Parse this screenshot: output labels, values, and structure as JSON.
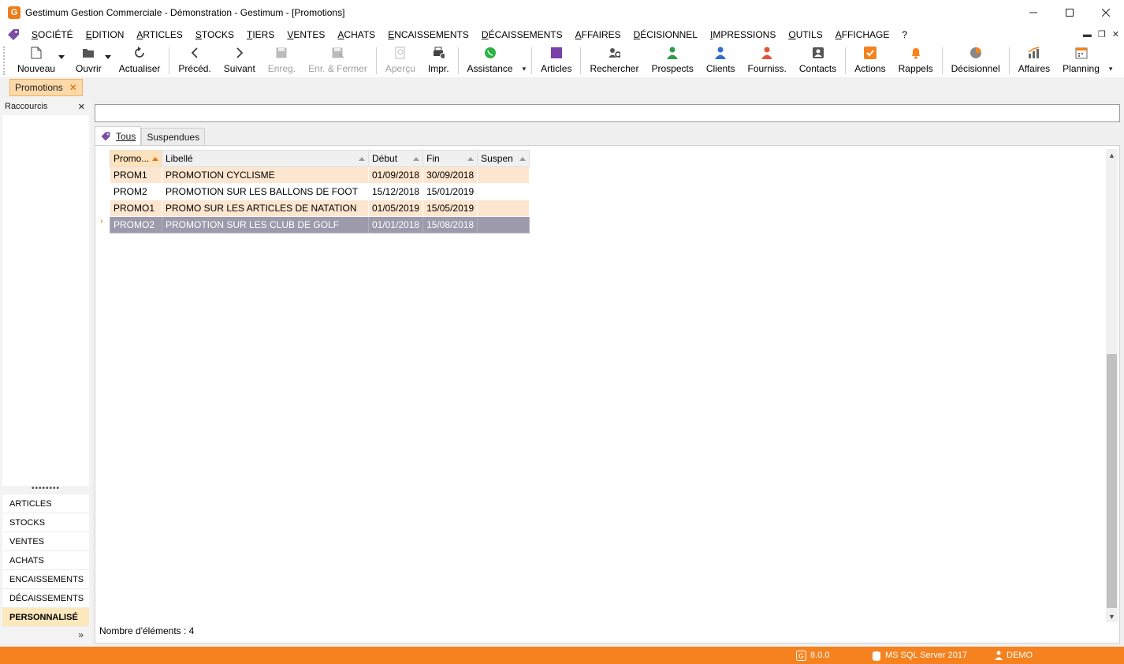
{
  "window": {
    "title": "Gestimum Gestion Commerciale - Démonstration - Gestimum - [Promotions]"
  },
  "menu": [
    "SOCIÉTÉ",
    "EDITION",
    "ARTICLES",
    "STOCKS",
    "TIERS",
    "VENTES",
    "ACHATS",
    "ENCAISSEMENTS",
    "DÉCAISSEMENTS",
    "AFFAIRES",
    "DÉCISIONNEL",
    "IMPRESSIONS",
    "OUTILS",
    "AFFICHAGE",
    "?"
  ],
  "toolbar": {
    "nouveau": "Nouveau",
    "ouvrir": "Ouvrir",
    "actualiser": "Actualiser",
    "preced": "Précéd.",
    "suivant": "Suivant",
    "enreg": "Enreg.",
    "enr_fermer": "Enr. & Fermer",
    "apercu": "Aperçu",
    "impr": "Impr.",
    "assistance": "Assistance",
    "articles": "Articles",
    "rechercher": "Rechercher",
    "prospects": "Prospects",
    "clients": "Clients",
    "fourniss": "Fourniss.",
    "contacts": "Contacts",
    "actions": "Actions",
    "rappels": "Rappels",
    "decisionnel": "Décisionnel",
    "affaires": "Affaires",
    "planning": "Planning"
  },
  "colors": {
    "accent": "#f5821f",
    "selected_row": "#9c9aab",
    "alt_row": "#fde6cf",
    "tab_active": "#fdd9a9"
  },
  "doc_tab": {
    "label": "Promotions",
    "close": "✕"
  },
  "sidebar": {
    "header": "Raccourcis",
    "close": "✕",
    "dots": "••••••••",
    "items": [
      "ARTICLES",
      "STOCKS",
      "VENTES",
      "ACHATS",
      "ENCAISSEMENTS",
      "DÉCAISSEMENTS",
      "PERSONNALISÉ"
    ],
    "more": "»"
  },
  "search": {
    "value": "",
    "placeholder": ""
  },
  "tabs": {
    "tous": "Tous",
    "suspendues": "Suspendues"
  },
  "grid": {
    "columns": [
      "Promo...",
      "Libellé",
      "Début",
      "Fin",
      "Suspen"
    ],
    "rows": [
      [
        "PROM1",
        "PROMOTION CYCLISME",
        "01/09/2018",
        "30/09/2018",
        ""
      ],
      [
        "PROM2",
        "PROMOTION SUR LES BALLONS DE FOOT",
        "15/12/2018",
        "15/01/2019",
        ""
      ],
      [
        "PROMO1",
        "PROMO SUR LES ARTICLES DE NATATION",
        "01/05/2019",
        "15/05/2019",
        ""
      ],
      [
        "PROMO2",
        "PROMOTION SUR LES CLUB DE GOLF",
        "01/01/2018",
        "15/08/2018",
        ""
      ]
    ]
  },
  "count_label": "Nombre d'éléments : 4",
  "status": {
    "version": "8.0.0",
    "server": "MS SQL Server 2017",
    "user": "DEMO"
  }
}
